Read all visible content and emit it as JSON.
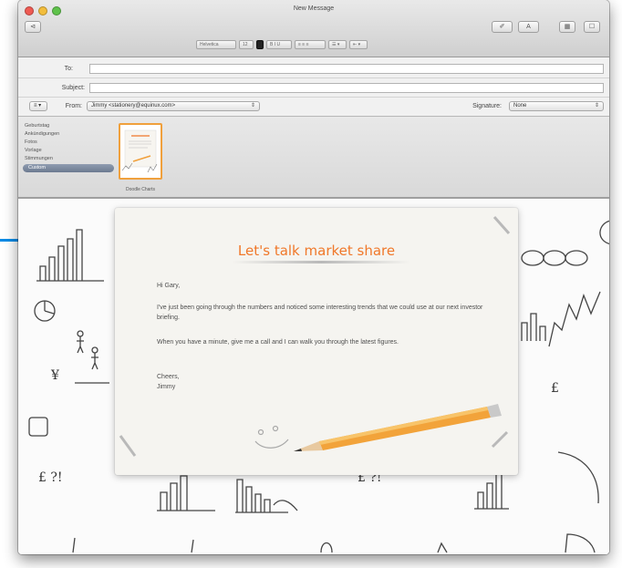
{
  "window": {
    "title": "New Message"
  },
  "toolbar": {
    "back_glyph": "⊲",
    "buttons": [
      {
        "icon": "paperclip-icon",
        "glyph": "✐"
      },
      {
        "icon": "format-icon",
        "glyph": "A"
      },
      {
        "icon": "photo-browser-icon",
        "glyph": "▦"
      },
      {
        "icon": "stationery-icon",
        "glyph": "☐"
      }
    ]
  },
  "format_bar": {
    "font": "Helvetica",
    "size": "12",
    "bold": "B",
    "styles": "B I U",
    "align": "≡ ≡ ≡",
    "lists": "☰ ▾",
    "indent": "⇤ ▾"
  },
  "header": {
    "to_label": "To:",
    "to_value": "",
    "subject_label": "Subject:",
    "subject_value": "",
    "from_label": "From:",
    "from_value": "Jimmy <stationery@equinux.com>",
    "signature_label": "Signature:",
    "signature_value": "None",
    "options_glyph": "≡ ▾"
  },
  "stationery": {
    "categories": [
      {
        "label": "Geburtstag",
        "selected": false
      },
      {
        "label": "Ankündigungen",
        "selected": false
      },
      {
        "label": "Fotos",
        "selected": false
      },
      {
        "label": "Vorlage",
        "selected": false
      },
      {
        "label": "Stimmungen",
        "selected": false
      },
      {
        "label": "Custom",
        "selected": true
      }
    ],
    "thumbnail_caption": "Doodle Charts"
  },
  "letter": {
    "title": "Let's talk market share",
    "greeting": "Hi Gary,",
    "paragraph1": "I've just been going through the numbers and noticed some interesting trends that we could use at our next investor briefing.",
    "paragraph2": "When you have a minute, give me a call and I can walk you through the latest figures.",
    "closing": "Cheers,",
    "signature": "Jimmy"
  },
  "doodle_symbols": {
    "pound": "£",
    "pound_question": "£ ?!",
    "yen": "¥"
  },
  "colors": {
    "accent_orange": "#f0782a",
    "callout_blue": "#0b8be6",
    "selected_category": "#7a879b"
  }
}
